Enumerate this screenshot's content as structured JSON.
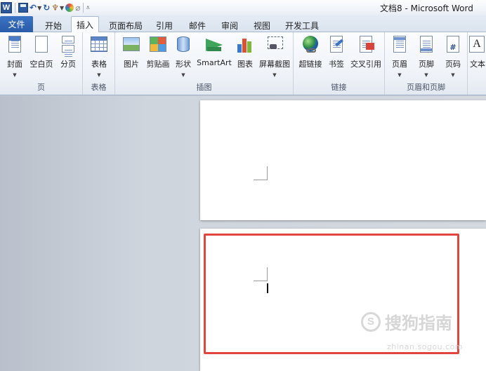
{
  "window": {
    "title": "文档8 - Microsoft Word"
  },
  "qat": {
    "app_icon": "W"
  },
  "tabs": [
    {
      "label": "文件",
      "id": "file"
    },
    {
      "label": "开始",
      "id": "home"
    },
    {
      "label": "插入",
      "id": "insert",
      "active": true
    },
    {
      "label": "页面布局",
      "id": "layout"
    },
    {
      "label": "引用",
      "id": "references"
    },
    {
      "label": "邮件",
      "id": "mailings"
    },
    {
      "label": "审阅",
      "id": "review"
    },
    {
      "label": "视图",
      "id": "view"
    },
    {
      "label": "开发工具",
      "id": "developer"
    }
  ],
  "ribbon": {
    "groups": {
      "pages": "页",
      "tables": "表格",
      "illustrations": "插图",
      "links": "链接",
      "header_footer": "页眉和页脚"
    },
    "buttons": {
      "cover": "封面",
      "blank": "空白页",
      "break": "分页",
      "table": "表格",
      "picture": "图片",
      "clipart": "剪贴画",
      "shapes": "形状",
      "smartart": "SmartArt",
      "chart": "图表",
      "screenshot": "屏幕截图",
      "hyperlink": "超链接",
      "bookmark": "书签",
      "crossref": "交叉引用",
      "header": "页眉",
      "footer": "页脚",
      "pagenum": "页码",
      "textbox": "文本"
    },
    "icon_glyphs": {
      "textbox": "A",
      "pagenum": "#"
    }
  },
  "watermark": {
    "brand": "搜狗指南",
    "logo": "S",
    "url": "zhinan.sogou.com"
  },
  "colors": {
    "file_tab": "#2a5ca8",
    "highlight_box": "#e0463f",
    "workspace": "#cfd5dd"
  }
}
